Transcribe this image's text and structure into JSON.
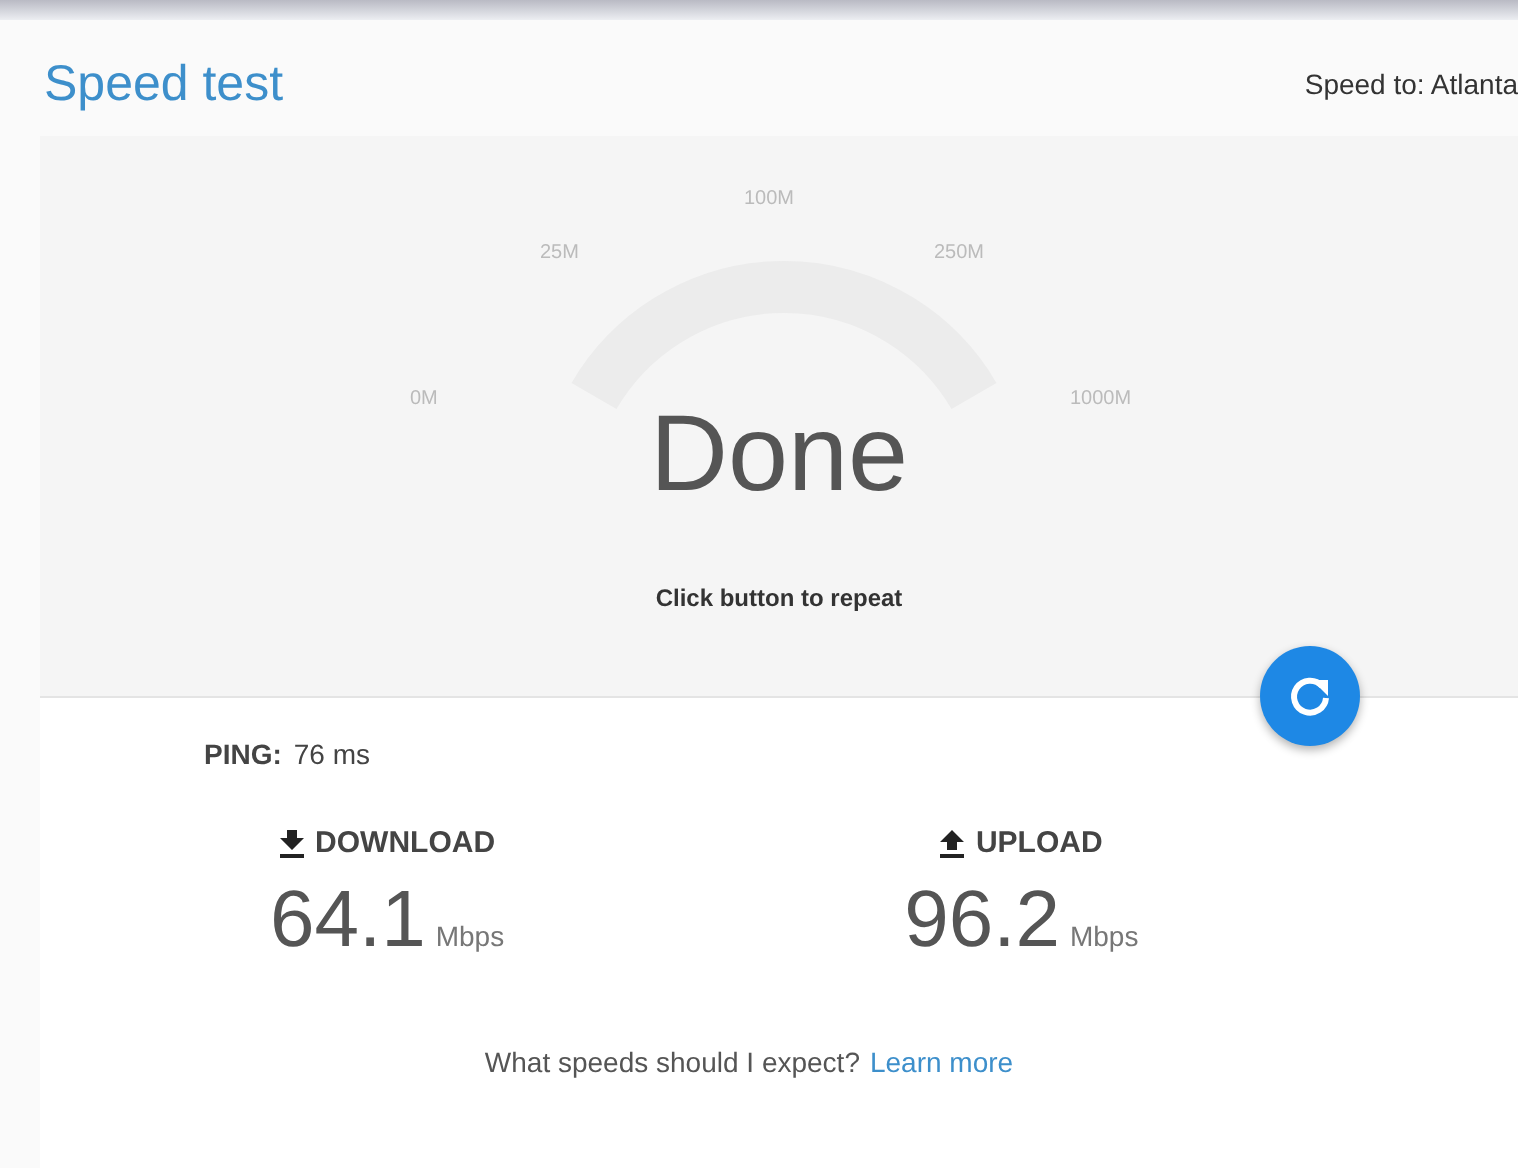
{
  "header": {
    "title": "Speed test",
    "server": "Speed to: Atlanta"
  },
  "gauge": {
    "labels": [
      "0M",
      "25M",
      "100M",
      "250M",
      "1000M"
    ],
    "status": "Done",
    "hint": "Click button to repeat"
  },
  "ping": {
    "label": "PING:",
    "value": "76 ms"
  },
  "results": [
    {
      "kind": "download",
      "label": "DOWNLOAD",
      "value": "64.1",
      "unit": "Mbps"
    },
    {
      "kind": "upload",
      "label": "UPLOAD",
      "value": "96.2",
      "unit": "Mbps"
    }
  ],
  "footer": {
    "text": "What speeds should I expect?",
    "link": "Learn more"
  }
}
